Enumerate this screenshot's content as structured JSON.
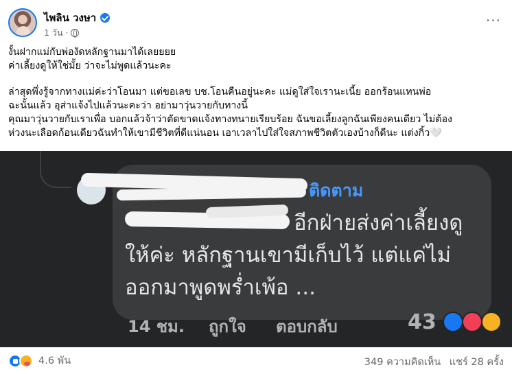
{
  "post": {
    "author": "ไพลิน วงษา",
    "time": "1 วัน ·",
    "more": "···",
    "paragraphs": [
      "งั้นฝากแม่กับพ่องัดหลักฐานมาได้เลยยยย",
      "ค่าเลี้ยงดูให้ใช่มั้ย ว่าจะไม่พูดแล้วนะคะ",
      "",
      "ล่าสุดพึ่งรู้จากทางแม่ค่ะว่าโอนมา แต่ขอเลข บช.โอนคืนอยู่นะคะ แม่ดูใส่ใจเรานะเนี้ย ออกร้อนแทนพ่อ",
      "ฉะนั้นแล้ว อุส่าแจ้งไปแล้วนะคะว่า อย่ามาวุ่นวายกับทางนี้",
      "คุณมาวุ่นวายกับเราเพื่อ บอกแล้วจ้าว่าตัดขาดแจ้งทางทนายเรียบร้อย ฉันขอเลี้ยงลูกฉันเพียงคนเดียว ไม่ต้อง",
      "ห่วงนะเลือดก้อนเดียวฉันทำให้เขามีชีวิตที่ดีแน่นอน เอาเวลาไปใส่ใจสภาพชีวิตตัวเองบ้างก็ดีนะ แต่งกิ้ว🤍"
    ]
  },
  "screenshot": {
    "follow": "ติดตาม",
    "comment_line1": "อีกฝ่ายส่งค่าเลี้ยงดู",
    "comment_line2": "ให้ค่ะ หลักฐานเขามีเก็บไว้ แต่แค่ไม่",
    "comment_line3": "ออกมาพูดพร่ำเพ้อ ...",
    "time": "14 ชม.",
    "like": "ถูกใจ",
    "reply": "ตอบกลับ",
    "reaction_count": "43"
  },
  "footer": {
    "reaction_count": "4.6 พัน",
    "comments": "349 ความคิดเห็น",
    "shares": "แชร์ 28 ครั้ง"
  },
  "colors": {
    "brand": "#1877f2",
    "dark_bg": "#242526",
    "bubble": "#3a3b3c",
    "link": "#4599ff",
    "muted": "#65676b"
  }
}
